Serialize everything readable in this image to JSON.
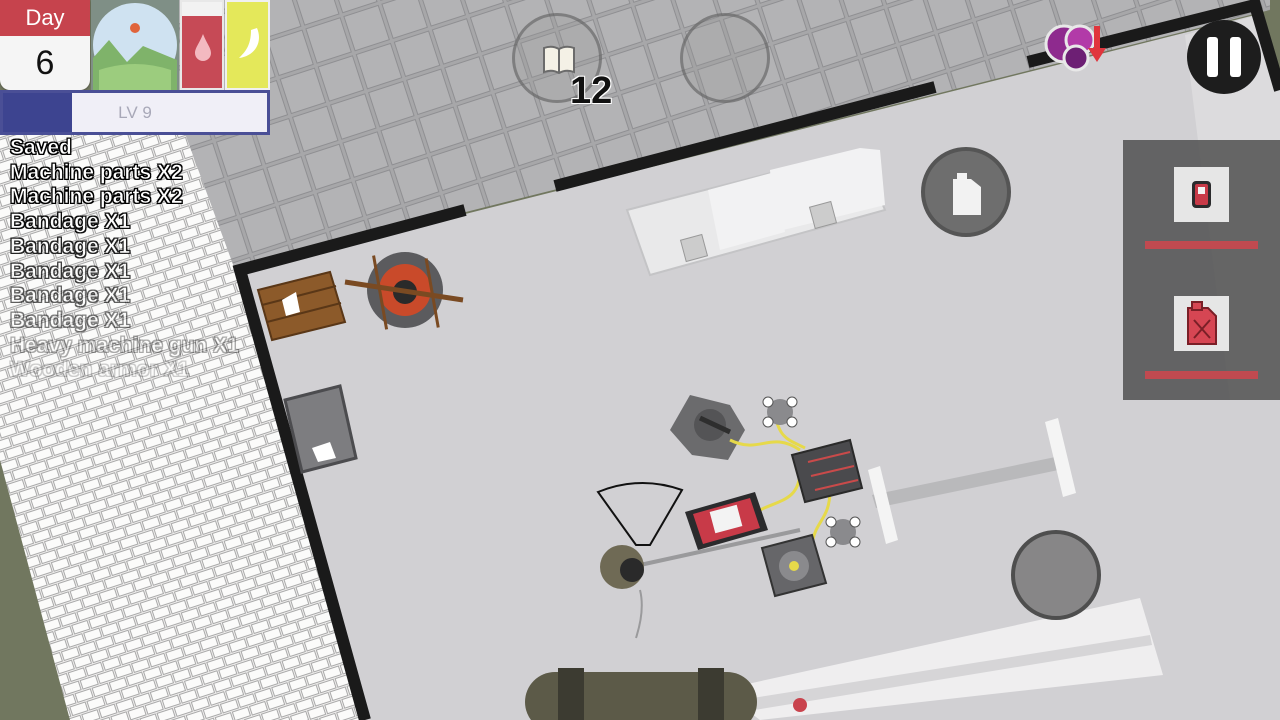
{
  "hud": {
    "day_label": "Day",
    "day_number": "6",
    "level_label": "LV 9",
    "level_progress": 0.26,
    "weather_icon": "sun-over-hills-icon",
    "thirst_icon": "water-drop-icon",
    "hunger_icon": "banana-icon"
  },
  "log": [
    "Saved",
    "Machine parts X2",
    "Machine parts X2",
    "Bandage X1",
    "Bandage X1",
    "Bandage X1",
    "Bandage X1",
    "Bandage X1",
    "Heavy machine gun X1",
    "Wooden armor X1"
  ],
  "buttons": {
    "journal_icon": "book-icon",
    "journal_count": "12",
    "fuel_icon": "fuel-canister-icon",
    "pause_icon": "pause-icon",
    "notification_icon": "resource-alert-icon"
  },
  "quick_slots": [
    {
      "item_icon": "generator-icon"
    },
    {
      "item_icon": "red-fuel-can-icon"
    }
  ],
  "colors": {
    "day_header": "#c6434d",
    "level_fill": "#3d4490",
    "thirst": "#c64a56",
    "hunger": "#e4e85a"
  }
}
